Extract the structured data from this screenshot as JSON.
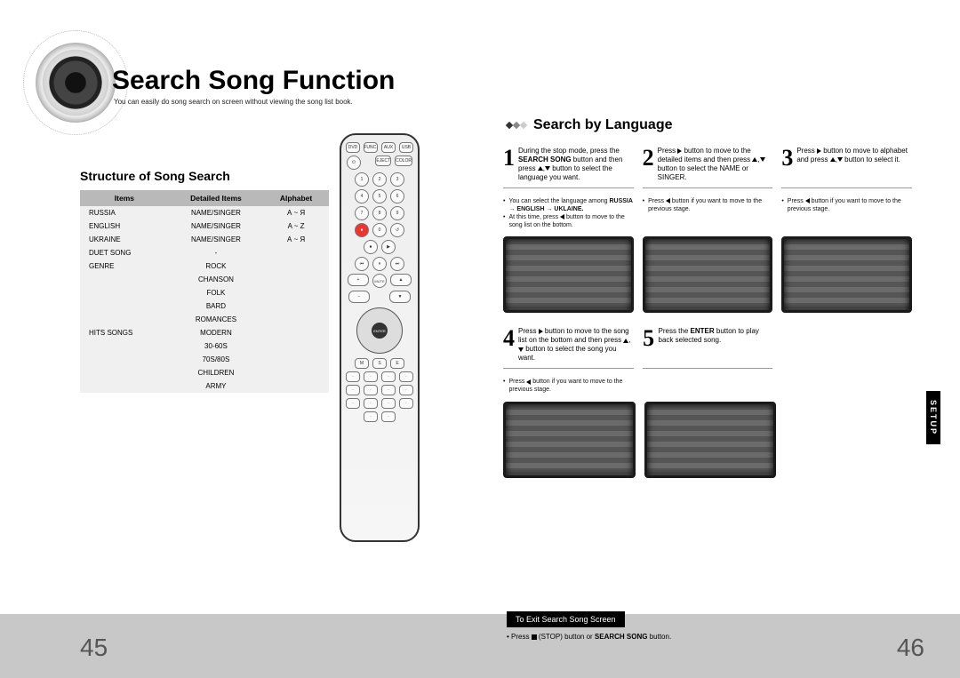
{
  "title": "Search Song Function",
  "subtitle": "You can easily do song search on screen without viewing the song list book.",
  "left": {
    "heading": "Structure of Song Search",
    "headers": [
      "Items",
      "Detailed Items",
      "Alphabet"
    ],
    "rows": [
      [
        "RUSSIA",
        "NAME/SINGER",
        "А ~ Я"
      ],
      [
        "ENGLISH",
        "NAME/SINGER",
        "A ~ Z"
      ],
      [
        "UKRAINE",
        "NAME/SINGER",
        "А ~ Я"
      ],
      [
        "DUET SONG",
        "-",
        ""
      ],
      [
        "GENRE",
        "ROCK",
        ""
      ],
      [
        "",
        "CHANSON",
        ""
      ],
      [
        "",
        "FOLK",
        ""
      ],
      [
        "",
        "BARD",
        ""
      ],
      [
        "",
        "ROMANCES",
        ""
      ],
      [
        "HITS SONGS",
        "MODERN",
        ""
      ],
      [
        "",
        "30-60S",
        ""
      ],
      [
        "",
        "70S/80S",
        ""
      ],
      [
        "",
        "CHILDREN",
        ""
      ],
      [
        "",
        "ARMY",
        ""
      ]
    ]
  },
  "remote": {
    "top_labels": [
      "DVD",
      "FUNC.",
      "AUX",
      "USB"
    ],
    "power": "POWER",
    "enter": "ENTER"
  },
  "right": {
    "heading": "Search by Language",
    "steps": [
      {
        "num": "1",
        "text": "During the stop mode, press the <b>SEARCH SONG</b> button and then press ▲,▼ button to select the language you want.",
        "notes": [
          "You can select the language among <b>RUSSIA → ENGLISH → UKLAINE.</b>",
          "At this time, press ◀ button to move to the song list on the bottom."
        ]
      },
      {
        "num": "2",
        "text": "Press ▶ button to move to the detailed items and then press ▲,▼ button to select the NAME or SINGER.",
        "notes": [
          "Press ◀ button if you want to move to the previous stage."
        ]
      },
      {
        "num": "3",
        "text": "Press ▶ button to move to alphabet and press ▲,▼ button to select it.",
        "notes": [
          "Press ◀ button if you want to move to the previous stage."
        ]
      },
      {
        "num": "4",
        "text": "Press ▶ button to move to the song list on the bottom and then press ▲,▼ button to select the song you want.",
        "notes": [
          "Press ◀ button if you want to move to the previous stage."
        ]
      },
      {
        "num": "5",
        "text": "Press the <b>ENTER</b> button to play back selected song.",
        "notes": []
      }
    ]
  },
  "footer": {
    "exit_head": "To Exit Search Song Screen",
    "exit_note": "Press ■ (STOP) button or <b>SEARCH SONG</b> button.",
    "page_left": "45",
    "page_right": "46",
    "tab": "SETUP"
  }
}
